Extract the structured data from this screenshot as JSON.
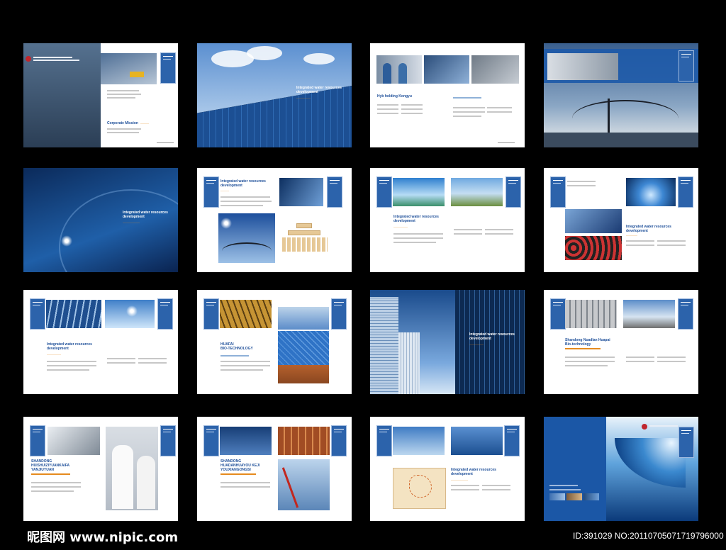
{
  "spreads": {
    "s1": {
      "heading": "Corporate Mission"
    },
    "s2": {
      "heading1": "Integrated water resources",
      "heading2": "development"
    },
    "s3": {
      "heading": "Hyb holding Kongyu"
    },
    "s5": {
      "heading1": "Integrated water resources",
      "heading2": "development"
    },
    "s6": {
      "heading1": "Integrated water resources",
      "heading2": "development"
    },
    "s7": {
      "heading1": "Integrated water resources",
      "heading2": "development"
    },
    "s8": {
      "heading1": "Integrated water resources",
      "heading2": "development"
    },
    "s9": {
      "heading1": "Integrated water resources",
      "heading2": "development"
    },
    "s10": {
      "heading1": "HUAFAI",
      "heading2": "BIO-TECHNOLOGY"
    },
    "s11": {
      "heading1": "Integrated water resources",
      "heading2": "development"
    },
    "s12": {
      "heading1": "Shandong Nuadlan Huapai",
      "heading2": "Bio-technology"
    },
    "s13": {
      "heading1": "SHANDONG",
      "heading2": "HUISHUIZIYUANKAIFA",
      "heading3": "YANJIUYUAN"
    },
    "s14": {
      "heading1": "SHANDONG",
      "heading2": "HUADANHUAYOU KEJI",
      "heading3": "YOUXIANGONGSI"
    },
    "s15": {
      "heading1": "Integrated water resources",
      "heading2": "development"
    }
  },
  "watermark": {
    "logo": "昵图网 www.nipic.com",
    "id_text": "ID:391029 NO:20110705071719796000"
  },
  "colors": {
    "background": "#000000",
    "brand_blue": "#1e5aa8",
    "accent_orange": "#e58a1e"
  }
}
